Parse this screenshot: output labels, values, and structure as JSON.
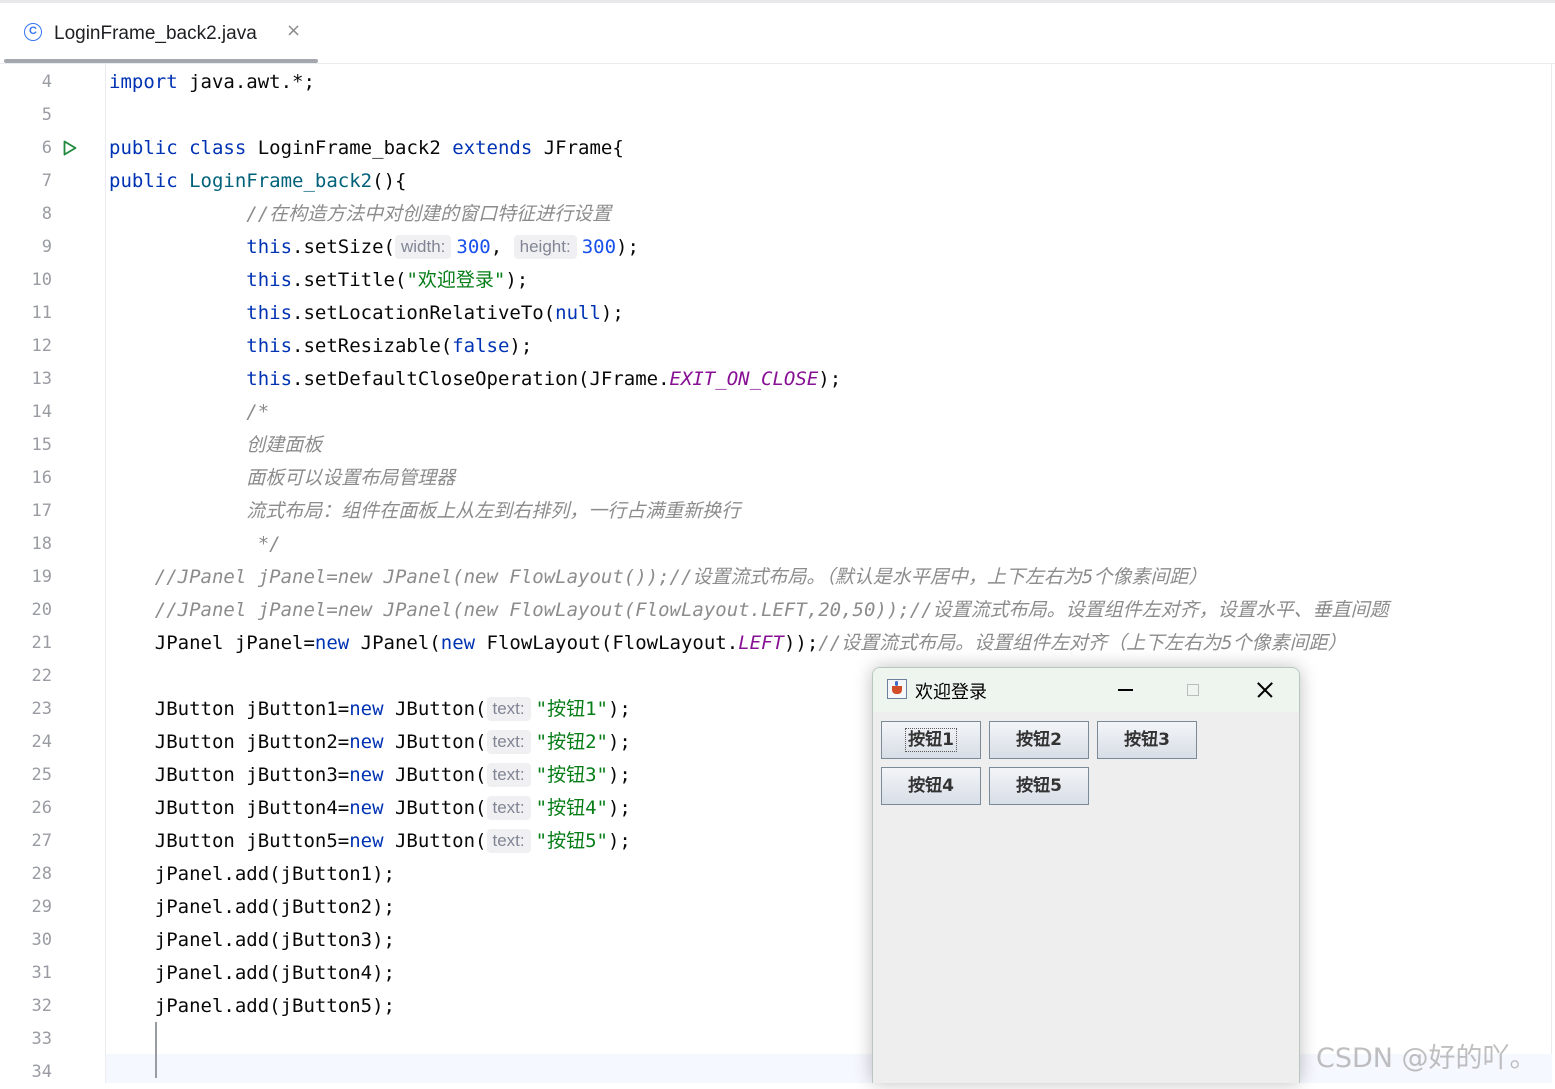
{
  "tab": {
    "icon": "class-c-icon",
    "icon_glyph": "C",
    "title": "LoginFrame_back2.java",
    "close": "×"
  },
  "line_numbers": [
    "4",
    "5",
    "6",
    "7",
    "8",
    "9",
    "10",
    "11",
    "12",
    "13",
    "14",
    "15",
    "16",
    "17",
    "18",
    "19",
    "20",
    "21",
    "22",
    "23",
    "24",
    "25",
    "26",
    "27",
    "28",
    "29",
    "30",
    "31",
    "32",
    "33",
    "34"
  ],
  "code_lines": [
    [
      {
        "t": "import",
        "c": "kw"
      },
      {
        "t": " java.awt.*;"
      }
    ],
    [],
    [
      {
        "t": "public",
        "c": "kw"
      },
      {
        "t": " "
      },
      {
        "t": "class",
        "c": "kw"
      },
      {
        "t": " LoginFrame_back2 "
      },
      {
        "t": "extends",
        "c": "kw"
      },
      {
        "t": " JFrame{"
      }
    ],
    [
      {
        "t": "public",
        "c": "kw"
      },
      {
        "t": " "
      },
      {
        "t": "LoginFrame_back2",
        "c": "fn"
      },
      {
        "t": "(){"
      }
    ],
    [
      {
        "t": "            "
      },
      {
        "t": "//在构造方法中对创建的窗口特征进行设置",
        "c": "cmt"
      }
    ],
    [
      {
        "t": "            "
      },
      {
        "t": "this",
        "c": "kw"
      },
      {
        "t": ".setSize("
      },
      {
        "t": "width:",
        "c": "hint"
      },
      {
        "t": "300",
        "c": "num"
      },
      {
        "t": ", "
      },
      {
        "t": "height:",
        "c": "hint"
      },
      {
        "t": "300",
        "c": "num"
      },
      {
        "t": ");"
      }
    ],
    [
      {
        "t": "            "
      },
      {
        "t": "this",
        "c": "kw"
      },
      {
        "t": ".setTitle("
      },
      {
        "t": "\"欢迎登录\"",
        "c": "str"
      },
      {
        "t": ");"
      }
    ],
    [
      {
        "t": "            "
      },
      {
        "t": "this",
        "c": "kw"
      },
      {
        "t": ".setLocationRelativeTo("
      },
      {
        "t": "null",
        "c": "kw"
      },
      {
        "t": ");"
      }
    ],
    [
      {
        "t": "            "
      },
      {
        "t": "this",
        "c": "kw"
      },
      {
        "t": ".setResizable("
      },
      {
        "t": "false",
        "c": "kw"
      },
      {
        "t": ");"
      }
    ],
    [
      {
        "t": "            "
      },
      {
        "t": "this",
        "c": "kw"
      },
      {
        "t": ".setDefaultCloseOperation(JFrame."
      },
      {
        "t": "EXIT_ON_CLOSE",
        "c": "const"
      },
      {
        "t": ");"
      }
    ],
    [
      {
        "t": "            "
      },
      {
        "t": "/*",
        "c": "cmt"
      }
    ],
    [
      {
        "t": "            "
      },
      {
        "t": "创建面板",
        "c": "cmt"
      }
    ],
    [
      {
        "t": "            "
      },
      {
        "t": "面板可以设置布局管理器",
        "c": "cmt"
      }
    ],
    [
      {
        "t": "            "
      },
      {
        "t": "流式布局：组件在面板上从左到右排列，一行占满重新换行",
        "c": "cmt"
      }
    ],
    [
      {
        "t": "             "
      },
      {
        "t": "*/",
        "c": "cmt"
      }
    ],
    [
      {
        "t": "    "
      },
      {
        "t": "//JPanel jPanel=new JPanel(new FlowLayout());//设置流式布局。（默认是水平居中，上下左右为5个像素间距）",
        "c": "cmt"
      }
    ],
    [
      {
        "t": "    "
      },
      {
        "t": "//JPanel jPanel=new JPanel(new FlowLayout(FlowLayout.LEFT,20,50));//设置流式布局。设置组件左对齐，设置水平、垂直间题",
        "c": "cmt"
      }
    ],
    [
      {
        "t": "    JPanel jPanel="
      },
      {
        "t": "new",
        "c": "kw"
      },
      {
        "t": " JPanel("
      },
      {
        "t": "new",
        "c": "kw"
      },
      {
        "t": " FlowLayout(FlowLayout."
      },
      {
        "t": "LEFT",
        "c": "const"
      },
      {
        "t": "));"
      },
      {
        "t": "//设置流式布局。设置组件左对齐（上下左右为5个像素间距）",
        "c": "cmt"
      }
    ],
    [],
    [
      {
        "t": "    JButton jButton1="
      },
      {
        "t": "new",
        "c": "kw"
      },
      {
        "t": " JButton("
      },
      {
        "t": "text:",
        "c": "hint"
      },
      {
        "t": "\"按钮1\"",
        "c": "str"
      },
      {
        "t": ");"
      }
    ],
    [
      {
        "t": "    JButton jButton2="
      },
      {
        "t": "new",
        "c": "kw"
      },
      {
        "t": " JButton("
      },
      {
        "t": "text:",
        "c": "hint"
      },
      {
        "t": "\"按钮2\"",
        "c": "str"
      },
      {
        "t": ");"
      }
    ],
    [
      {
        "t": "    JButton jButton3="
      },
      {
        "t": "new",
        "c": "kw"
      },
      {
        "t": " JButton("
      },
      {
        "t": "text:",
        "c": "hint"
      },
      {
        "t": "\"按钮3\"",
        "c": "str"
      },
      {
        "t": ");"
      }
    ],
    [
      {
        "t": "    JButton jButton4="
      },
      {
        "t": "new",
        "c": "kw"
      },
      {
        "t": " JButton("
      },
      {
        "t": "text:",
        "c": "hint"
      },
      {
        "t": "\"按钮4\"",
        "c": "str"
      },
      {
        "t": ");"
      }
    ],
    [
      {
        "t": "    JButton jButton5="
      },
      {
        "t": "new",
        "c": "kw"
      },
      {
        "t": " JButton("
      },
      {
        "t": "text:",
        "c": "hint"
      },
      {
        "t": "\"按钮5\"",
        "c": "str"
      },
      {
        "t": ");"
      }
    ],
    [
      {
        "t": "    jPanel.add(jButton1);"
      }
    ],
    [
      {
        "t": "    jPanel.add(jButton2);"
      }
    ],
    [
      {
        "t": "    jPanel.add(jButton3);"
      }
    ],
    [
      {
        "t": "    jPanel.add(jButton4);"
      }
    ],
    [
      {
        "t": "    jPanel.add(jButton5);"
      }
    ],
    [],
    []
  ],
  "jframe": {
    "title": "欢迎登录",
    "icon": "java-cup-icon",
    "minimize_icon": "minimize-icon",
    "maximize_icon": "maximize-icon",
    "close_icon": "close-icon",
    "buttons": [
      "按钮1",
      "按钮2",
      "按钮3",
      "按钮4",
      "按钮5"
    ],
    "focused_button": "按钮1"
  },
  "watermark": "CSDN @好的吖。",
  "colors": {
    "keyword": "#0033b3",
    "method": "#00627a",
    "number": "#1750eb",
    "string": "#067d17",
    "constant": "#871094",
    "comment": "#8c8c8c",
    "accent": "#3574f0"
  }
}
